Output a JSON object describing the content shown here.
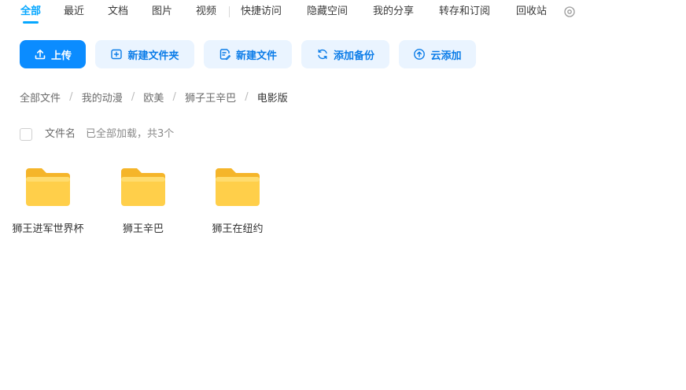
{
  "tabs": [
    {
      "label": "全部",
      "active": true
    },
    {
      "label": "最近"
    },
    {
      "label": "文档"
    },
    {
      "label": "图片"
    },
    {
      "label": "视频"
    },
    {
      "label": "快捷访问"
    },
    {
      "label": "隐藏空间"
    },
    {
      "label": "我的分享"
    },
    {
      "label": "转存和订阅"
    },
    {
      "label": "回收站"
    }
  ],
  "toolbar": {
    "upload": "上传",
    "new_folder": "新建文件夹",
    "new_file": "新建文件",
    "add_backup": "添加备份",
    "cloud_add": "云添加"
  },
  "breadcrumb": [
    "全部文件",
    "我的动漫",
    "欧美",
    "狮子王辛巴",
    "电影版"
  ],
  "breadcrumb_separator": "/",
  "list": {
    "column_name": "文件名",
    "load_status": "已全部加载，共3个"
  },
  "folders": [
    {
      "name": "狮王进军世界杯"
    },
    {
      "name": "狮王辛巴"
    },
    {
      "name": "狮王在纽约"
    }
  ],
  "colors": {
    "accent": "#06a7ff",
    "primary_button": "#0b8cff",
    "secondary_button_bg": "#eaf4ff",
    "folder_yellow": "#ffc83d"
  },
  "icons": {
    "upload": "upload-icon",
    "new_folder": "folder-plus-icon",
    "new_file": "file-edit-icon",
    "add_backup": "sync-icon",
    "cloud_add": "cloud-upload-icon",
    "more": "more-circle-icon",
    "folder": "folder-icon"
  }
}
